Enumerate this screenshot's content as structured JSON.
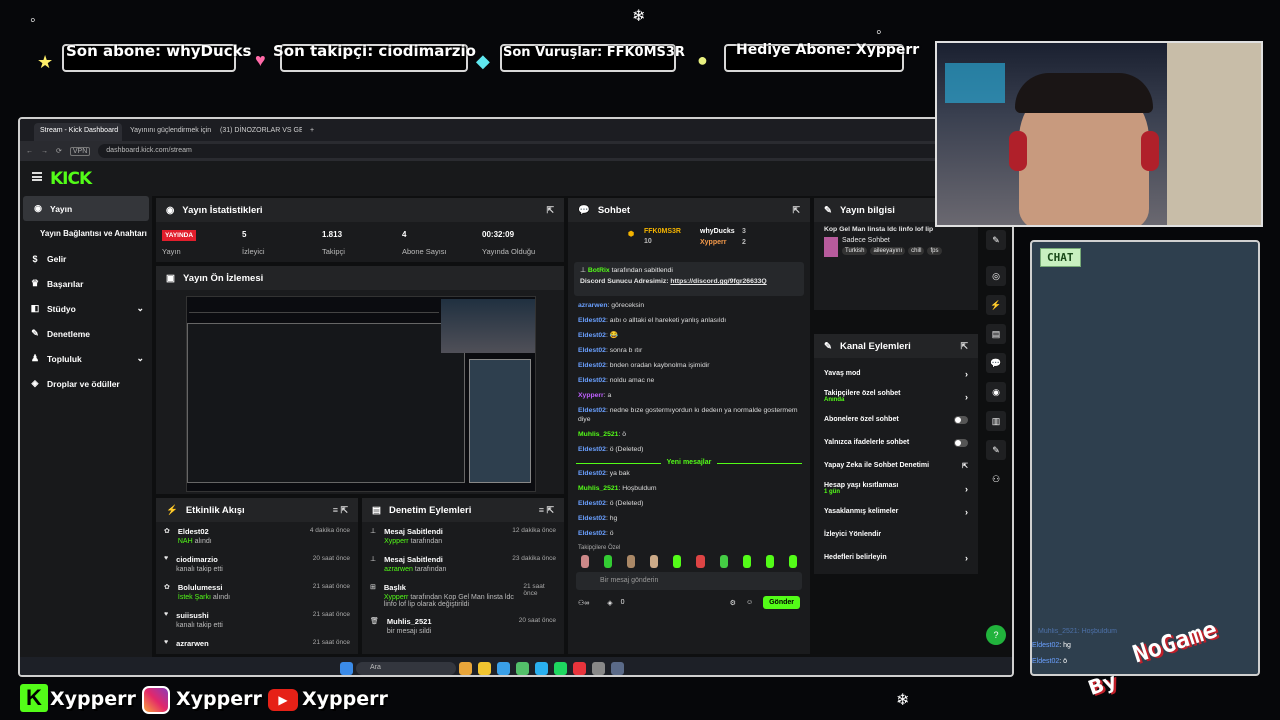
{
  "overlay": {
    "last_sub": "Son abone: whyDucks",
    "last_follower": "Son takipçi: ciodimarzio",
    "last_hit": "Son Vuruşlar: FFK0MS3R",
    "gift_sub": "Hediye Abone: Xypperr",
    "chat_label": "CHAT",
    "watermark_by": "By",
    "watermark_brand": "NoGame",
    "socials": [
      {
        "platform": "kick-icon",
        "handle": "Xypperr"
      },
      {
        "platform": "instagram-icon",
        "handle": "Xypperr"
      },
      {
        "platform": "youtube-icon",
        "handle": "Xypperr"
      }
    ],
    "chat_lines": [
      {
        "user": "Muhlis_2521",
        "text": "Hoşbuldum"
      },
      {
        "user": "Eldest02",
        "text": "hg"
      },
      {
        "user": "Eldest02",
        "text": "ö"
      }
    ]
  },
  "browser": {
    "tabs": [
      "Stream - Kick Dashboard",
      "Yayınını güçlendirmek için",
      "(31) DİNOZORLAR VS GE"
    ],
    "url": "dashboard.kick.com/stream",
    "vpn": "VPN"
  },
  "kick": {
    "logo": "KICK",
    "sidebar": [
      {
        "label": "Yayın",
        "icon": "broadcast-icon"
      },
      {
        "label": "Yayın Bağlantısı ve Anahtarı",
        "icon": ""
      },
      {
        "label": "Gelir",
        "icon": "money-icon"
      },
      {
        "label": "Başarılar",
        "icon": "trophy-icon"
      },
      {
        "label": "Stüdyo",
        "icon": "studio-icon",
        "chevron": true
      },
      {
        "label": "Denetleme",
        "icon": "wrench-icon"
      },
      {
        "label": "Topluluk",
        "icon": "community-icon",
        "chevron": true
      },
      {
        "label": "Droplar ve ödüller",
        "icon": "gift-icon"
      }
    ],
    "stats": {
      "title": "Yayın İstatistikleri",
      "live_badge": "YAYINDA",
      "live_label": "Yayın",
      "cells": [
        {
          "value": "5",
          "label": "İzleyici"
        },
        {
          "value": "1.813",
          "label": "Takipçi"
        },
        {
          "value": "4",
          "label": "Abone Sayısı"
        },
        {
          "value": "00:32:09",
          "label": "Yayında Olduğu"
        }
      ]
    },
    "preview_title": "Yayın Ön İzlemesi",
    "activity": {
      "title": "Etkinlik Akışı",
      "items": [
        {
          "name": "Eldest02",
          "detail_highlight": "NAH",
          "detail": "alındı",
          "time": "4 dakika önce"
        },
        {
          "name": "ciodimarzio",
          "detail_highlight": "",
          "detail": "kanalı takip etti",
          "time": "20 saat önce"
        },
        {
          "name": "Bolulumessi",
          "detail_highlight": "İstek Şarkı",
          "detail": "alındı",
          "time": "21 saat önce"
        },
        {
          "name": "suiisushi",
          "detail_highlight": "",
          "detail": "kanalı takip etti",
          "time": "21 saat önce"
        },
        {
          "name": "azrarwen",
          "detail_highlight": "",
          "detail": "",
          "time": "21 saat önce"
        }
      ]
    },
    "moderation": {
      "title": "Denetim Eylemleri",
      "items": [
        {
          "name": "Mesaj Sabitlendi",
          "actor": "Xypperr",
          "detail": "tarafından",
          "time": "12 dakika önce"
        },
        {
          "name": "Mesaj Sabitlendi",
          "actor": "azrarwen",
          "detail": "tarafından",
          "time": "23 dakika önce"
        },
        {
          "name": "Başlık",
          "actor": "Xypperr",
          "detail": "tarafından Kop Gel Man linsta ldc linfo lof lip olarak değiştirildi",
          "time": "21 saat önce"
        },
        {
          "name": "Muhlis_2521",
          "actor": "",
          "detail": "bir mesajı sildi",
          "time": "20 saat önce"
        }
      ]
    },
    "chat": {
      "title": "Sohbet",
      "top_gifters": [
        {
          "name": "FFK0MS3R",
          "count": "10"
        },
        {
          "name": "whyDucks",
          "count": "3"
        },
        {
          "name": "Xypperr",
          "count": "2"
        }
      ],
      "pinned_by": "BotRix",
      "pinned_suffix": "tarafından sabitlendi",
      "pinned_text": "Discord Sunucu Adresimiz:",
      "pinned_link": "https://discord.gg/9fgr26633Q",
      "messages": [
        {
          "user": "azrarwen",
          "text": "göreceksin",
          "cls": "u"
        },
        {
          "user": "Eldest02",
          "text": "aıbı o alltaki el hareketi yanlış anlasıldı",
          "cls": "u"
        },
        {
          "user": "Eldest02",
          "text": "😂",
          "cls": "u"
        },
        {
          "user": "Eldest02",
          "text": "sonra b ıtır",
          "cls": "u"
        },
        {
          "user": "Eldest02",
          "text": "bnden oradan kaybnolma işimidir",
          "cls": "u"
        },
        {
          "user": "Eldest02",
          "text": "noldu amac ne",
          "cls": "u"
        },
        {
          "user": "Xypperr",
          "text": "a",
          "cls": "up"
        },
        {
          "user": "Eldest02",
          "text": "nedne bıze gostermıyordun kı dedeın ya normalde gostermem diye",
          "cls": "u"
        },
        {
          "user": "Muhlis_2521",
          "text": "ö",
          "cls": "ug"
        },
        {
          "user": "Eldest02",
          "text": "ö (Deleted)",
          "cls": "u"
        }
      ],
      "new_messages_label": "Yeni mesajlar",
      "messages2": [
        {
          "user": "Eldest02",
          "text": "ya bak",
          "cls": "u"
        },
        {
          "user": "Muhlis_2521",
          "text": "Hoşbuldum",
          "cls": "ug"
        },
        {
          "user": "Eldest02",
          "text": "ö (Deleted)",
          "cls": "u"
        },
        {
          "user": "Eldest02",
          "text": "hg",
          "cls": "u"
        },
        {
          "user": "Eldest02",
          "text": "ö",
          "cls": "u"
        }
      ],
      "followers_special": "Takipçilere Özel",
      "input_placeholder": "Bir mesaj gönderin",
      "send_label": "Gönder",
      "counter": "0"
    },
    "stream_info": {
      "title": "Yayın bilgisi",
      "stream_title": "Kop Gel Man linsta ldc linfo lof lip",
      "category": "Sadece Sohbet",
      "tags": [
        "Turkish",
        "aileeyayını",
        "chill",
        "fps"
      ]
    },
    "channel_actions": {
      "title": "Kanal Eylemleri",
      "rows": [
        {
          "label": "Yavaş mod",
          "sub": "",
          "control": "chevron"
        },
        {
          "label": "Takipçilere özel sohbet",
          "sub": "Anında",
          "control": "chevron"
        },
        {
          "label": "Abonelere özel sohbet",
          "sub": "",
          "control": "toggle"
        },
        {
          "label": "Yalnızca ifadelerle sohbet",
          "sub": "",
          "control": "toggle"
        },
        {
          "label": "Yapay Zeka ile Sohbet Denetimi",
          "sub": "",
          "control": "ext"
        },
        {
          "label": "Hesap yaşı kısıtlaması",
          "sub": "1 gün",
          "control": "chevron"
        },
        {
          "label": "Yasaklanmış kelimeler",
          "sub": "",
          "control": "chevron"
        },
        {
          "label": "İzleyici Yönlendir",
          "sub": "",
          "control": "none"
        },
        {
          "label": "Hedefleri belirleyin",
          "sub": "",
          "control": "chevron"
        }
      ]
    },
    "taskbar": {
      "search": "Ara"
    }
  },
  "colors": {
    "kick_green": "#53fc18",
    "live_red": "#e21e2c",
    "chat_bg": "#2e3f4e"
  }
}
